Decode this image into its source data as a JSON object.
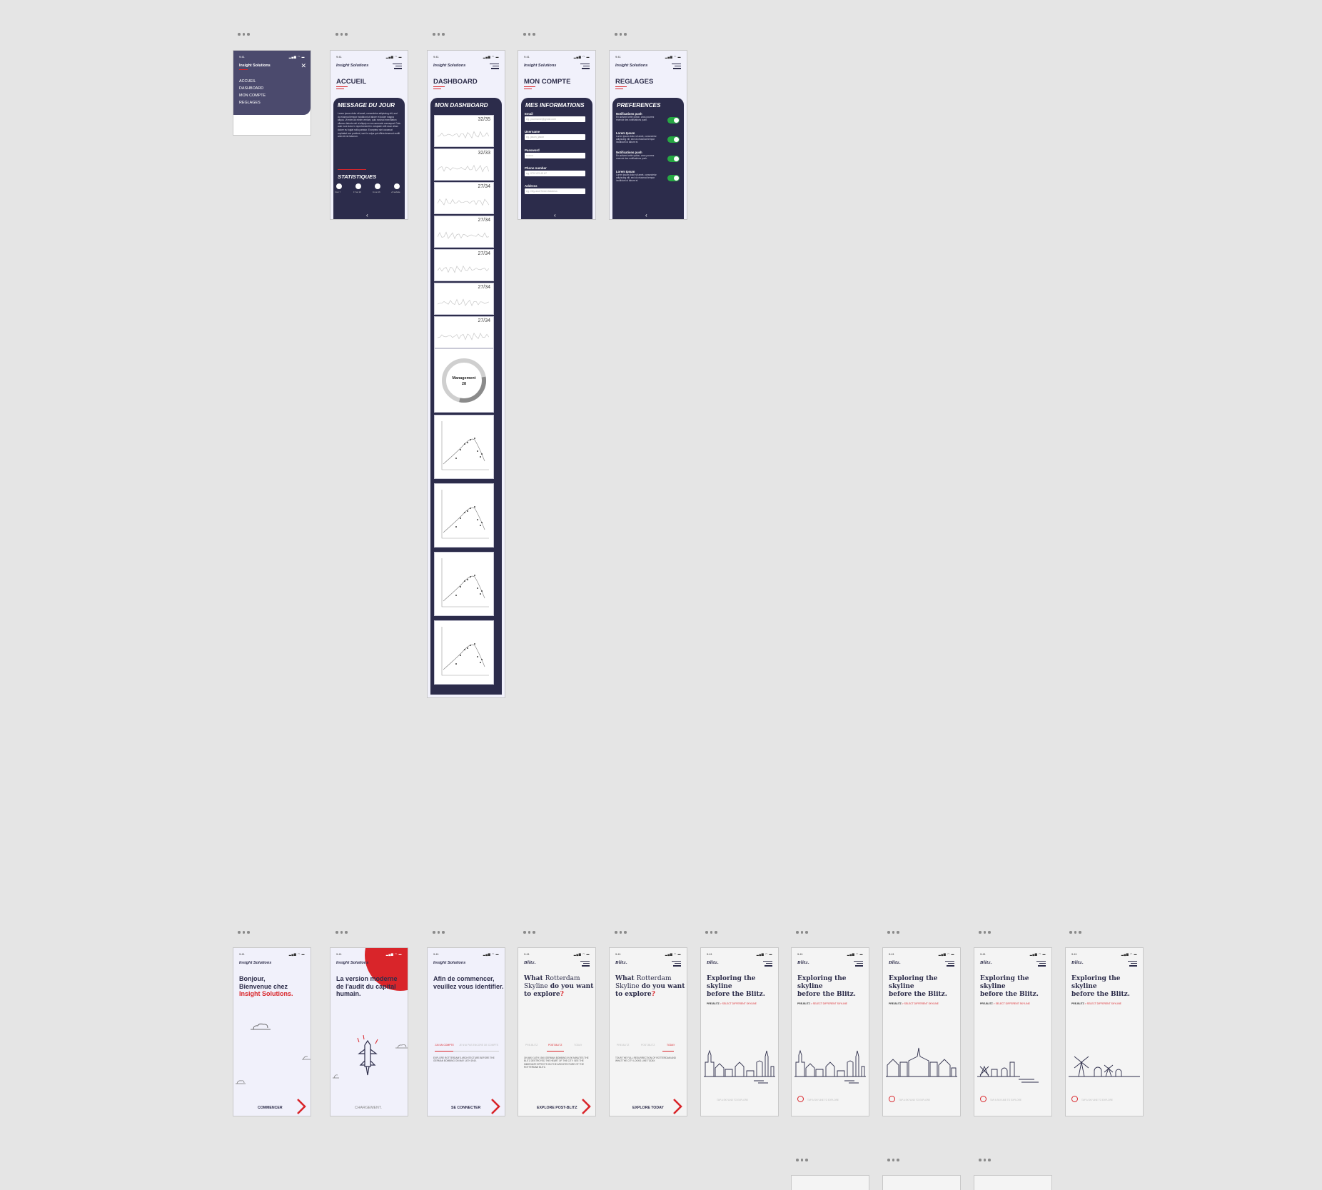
{
  "status": {
    "time": "9:41",
    "icons": "▂▄▆ ◠ ▬"
  },
  "brand": "Insight Solutions",
  "blitz_brand": "Blitz.",
  "menu": {
    "brand": "Insight Solutions",
    "items": [
      {
        "label": "ACCUEIL"
      },
      {
        "label": "DASHBOARD"
      },
      {
        "label": "MON COMPTE"
      },
      {
        "label": "REGLAGES"
      }
    ]
  },
  "accueil": {
    "title": "ACCUEIL",
    "panel_title": "MESSAGE DU JOUR",
    "message": "Lorem ipsum dolor sit amet, consectetur adipiscing elit, sed do eiusmod tempor incididunt ut labore et dolore magna aliqua. Ut enim ad minim veniam, quis nostrud exercitation ullamco laboris nisi ut aliquip ex ea commodo consequat. Duis aute irure dolor in reprehenderit in voluptate velit esse cillum dolore eu fugiat nulla pariatur. Excepteur sint occaecat cupidatat non proident, sunt in culpa qui officia deserunt mollit anim id est laborum.",
    "stats_title": "STATISTIQUES",
    "stats": [
      {
        "label": "0 sur 7"
      },
      {
        "label": "17 sur 23"
      },
      {
        "label": "11 sur 16"
      },
      {
        "label": "+5 website"
      }
    ]
  },
  "dashboard": {
    "title": "DASHBOARD",
    "panel_title": "MON DASHBOARD",
    "cards": [
      {
        "value": "32/35"
      },
      {
        "value": "32/33"
      },
      {
        "value": "27/34"
      },
      {
        "value": "27/34"
      },
      {
        "value": "27/34"
      },
      {
        "value": "27/34"
      },
      {
        "value": "27/34"
      }
    ],
    "donut": {
      "label": "Management",
      "value": "28"
    }
  },
  "compte": {
    "title": "MON COMPTE",
    "panel_title": "MES INFORMATIONS",
    "fields": [
      {
        "label": "Email",
        "placeholder": "eg. yourname@gmail.com"
      },
      {
        "label": "Username",
        "placeholder": "eg. jason_jason"
      },
      {
        "label": "Password",
        "placeholder": "••••••••"
      },
      {
        "label": "Phone number",
        "placeholder": "eg. 079 123 45 67"
      },
      {
        "label": "Address",
        "placeholder": "eg. City and Street Address"
      }
    ]
  },
  "reglages": {
    "title": "REGLAGES",
    "panel_title": "PREFERENCES",
    "items": [
      {
        "label": "Notifications push",
        "text": "En activant cette option, vous pourrez recevoir des notifications push."
      },
      {
        "label": "Lorem Ipsum",
        "text": "Lorem ipsum dolor sit amet, consectetur adipiscing elit, sed do eiusmod tempor incididunt ut labore et."
      },
      {
        "label": "Notifications push",
        "text": "En activant cette option, vous pourrez recevoir des notifications push."
      },
      {
        "label": "Lorem Ipsum",
        "text": "Lorem ipsum dolor sit amet, consectetur adipiscing elit, sed do eiusmod tempor incididunt ut labore et."
      }
    ]
  },
  "onboarding": {
    "welcome": {
      "line1": "Bonjour,",
      "line2": "Bienvenue chez",
      "line3": "Insight Solutions.",
      "cta": "COMMENCER"
    },
    "loading": {
      "line1": "La version moderne",
      "line2": "de l'audit du capital",
      "line3": "humain.",
      "cta": "CHARGEMENT."
    },
    "login": {
      "line1": "Afin de commencer,",
      "line2": "veuillez vous identifier.",
      "tab1": "J'AI UN COMPTE",
      "tab2": "JE N'AI PAS ENCORE DE COMPTE",
      "body": "EXPLORE ROTTERDAM'S ARCHITECTURE BEFORE THE GERMAN BOMBING ON MAY 14TH 1940.",
      "cta": "SE CONNECTER"
    }
  },
  "blitz": {
    "question_a": "What",
    "question_b": "Rotterdam",
    "question_c": "Skyline",
    "question_d": "do you want to explore",
    "question_mark": "?",
    "tabs": [
      "PRE-BLITZ",
      "POST-BLITZ",
      "TODAY"
    ],
    "body_post": "ON MAY 14TH 1940 GERMAN BOMBING IN 90 MINUTES THE BLITZ DESTROYED THE HEART OF THE CITY. SEE THE IMMEDIATE EFFECTS ON THE ARCHITECTURE OF THE ROTTERDAM BLITZ.",
    "body_today": "TOUR THE FULL RESURRECTION OF ROTTERDAM AND WHAT THE CITY LOOKS LIKE TODAY.",
    "cta_post": "EXPLORE POST-BLITZ",
    "cta_today": "EXPLORE TODAY",
    "explore_title_1": "Exploring the skyline",
    "explore_title_2": "before the Blitz.",
    "crumb_a": "PRE-BLITZ",
    "crumb_b": "> SELECT DIFFERENT SKYLINE",
    "caption": "TAP A SKYLINE TO EXPLORE"
  }
}
